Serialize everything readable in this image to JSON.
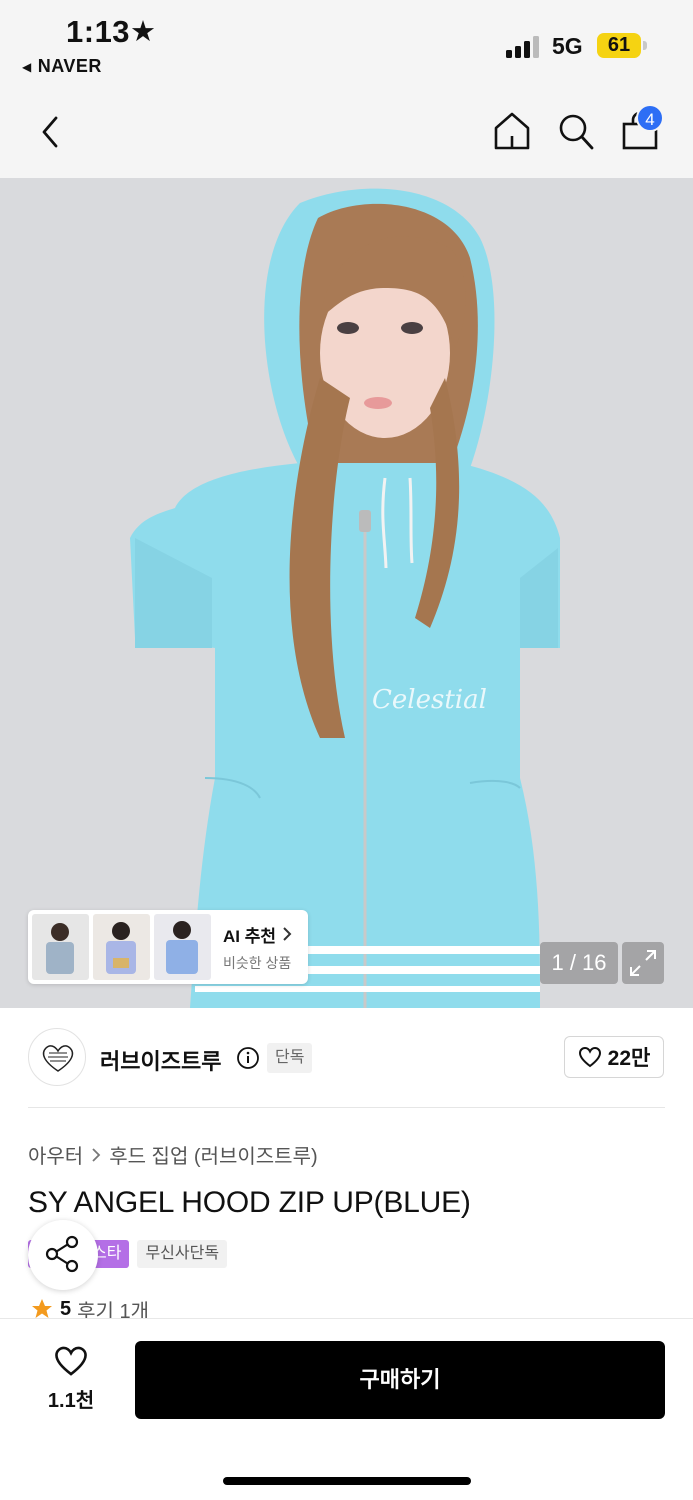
{
  "status_bar": {
    "time": "1:13",
    "star": "★",
    "back_app": "NAVER",
    "network": "5G",
    "battery": "61"
  },
  "nav": {
    "cart_count": "4"
  },
  "hero": {
    "ai_recommend": {
      "title": "AI 추천",
      "subtitle": "비슷한 상품"
    },
    "image_counter": "1 / 16",
    "image_index": 1,
    "image_total": 16
  },
  "brand": {
    "name": "러브이즈트루",
    "exclusive_tag": "단독",
    "likes": "22만"
  },
  "product": {
    "breadcrumb": [
      "아우터",
      "후드 집업 (러브이즈트루)"
    ],
    "title": "SY ANGEL HOOD ZIP UP(BLUE)",
    "tags": {
      "star_tag": "스타",
      "exclusive_tag": "무신사단독"
    },
    "rating": {
      "score": "5",
      "reviews": "후기 1개"
    }
  },
  "bottom_bar": {
    "wish_count": "1.1천",
    "buy_label": "구매하기"
  },
  "colors": {
    "badge_blue": "#2d6ef5",
    "battery_yellow": "#f5d312",
    "star_tag_purple": "#b46fe6",
    "hoodie_blue": "#8fdcec",
    "buy_button": "#000000"
  }
}
